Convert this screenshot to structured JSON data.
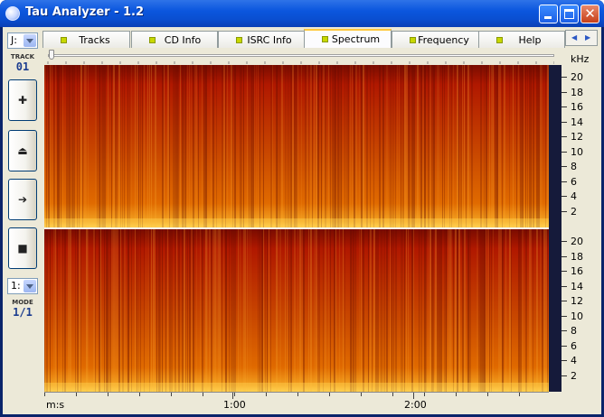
{
  "window": {
    "title": "Tau Analyzer - 1.2"
  },
  "left_panel": {
    "drive_select": {
      "value": "J:"
    },
    "track_label": "TRACK",
    "track_value": "01",
    "mode_select": {
      "value": "1:"
    },
    "mode_label": "MODE",
    "mode_value": "1/1"
  },
  "tabs": [
    {
      "label": "Tracks",
      "active": false
    },
    {
      "label": "CD Info",
      "active": false
    },
    {
      "label": "ISRC Info",
      "active": false
    },
    {
      "label": "Spectrum",
      "active": true
    },
    {
      "label": "Frequency",
      "active": false
    },
    {
      "label": "Help",
      "active": false
    }
  ],
  "spectrum": {
    "freq_unit": "kHz",
    "time_unit": "m:s",
    "freq_ticks": [
      "20",
      "18",
      "16",
      "14",
      "12",
      "10",
      "8",
      "6",
      "4",
      "2"
    ],
    "time_ticks": [
      "1:00",
      "2:00"
    ],
    "colors": {
      "low": "#b01800",
      "mid": "#e06a00",
      "high": "#ffd050",
      "edge": "#151a3a"
    }
  }
}
